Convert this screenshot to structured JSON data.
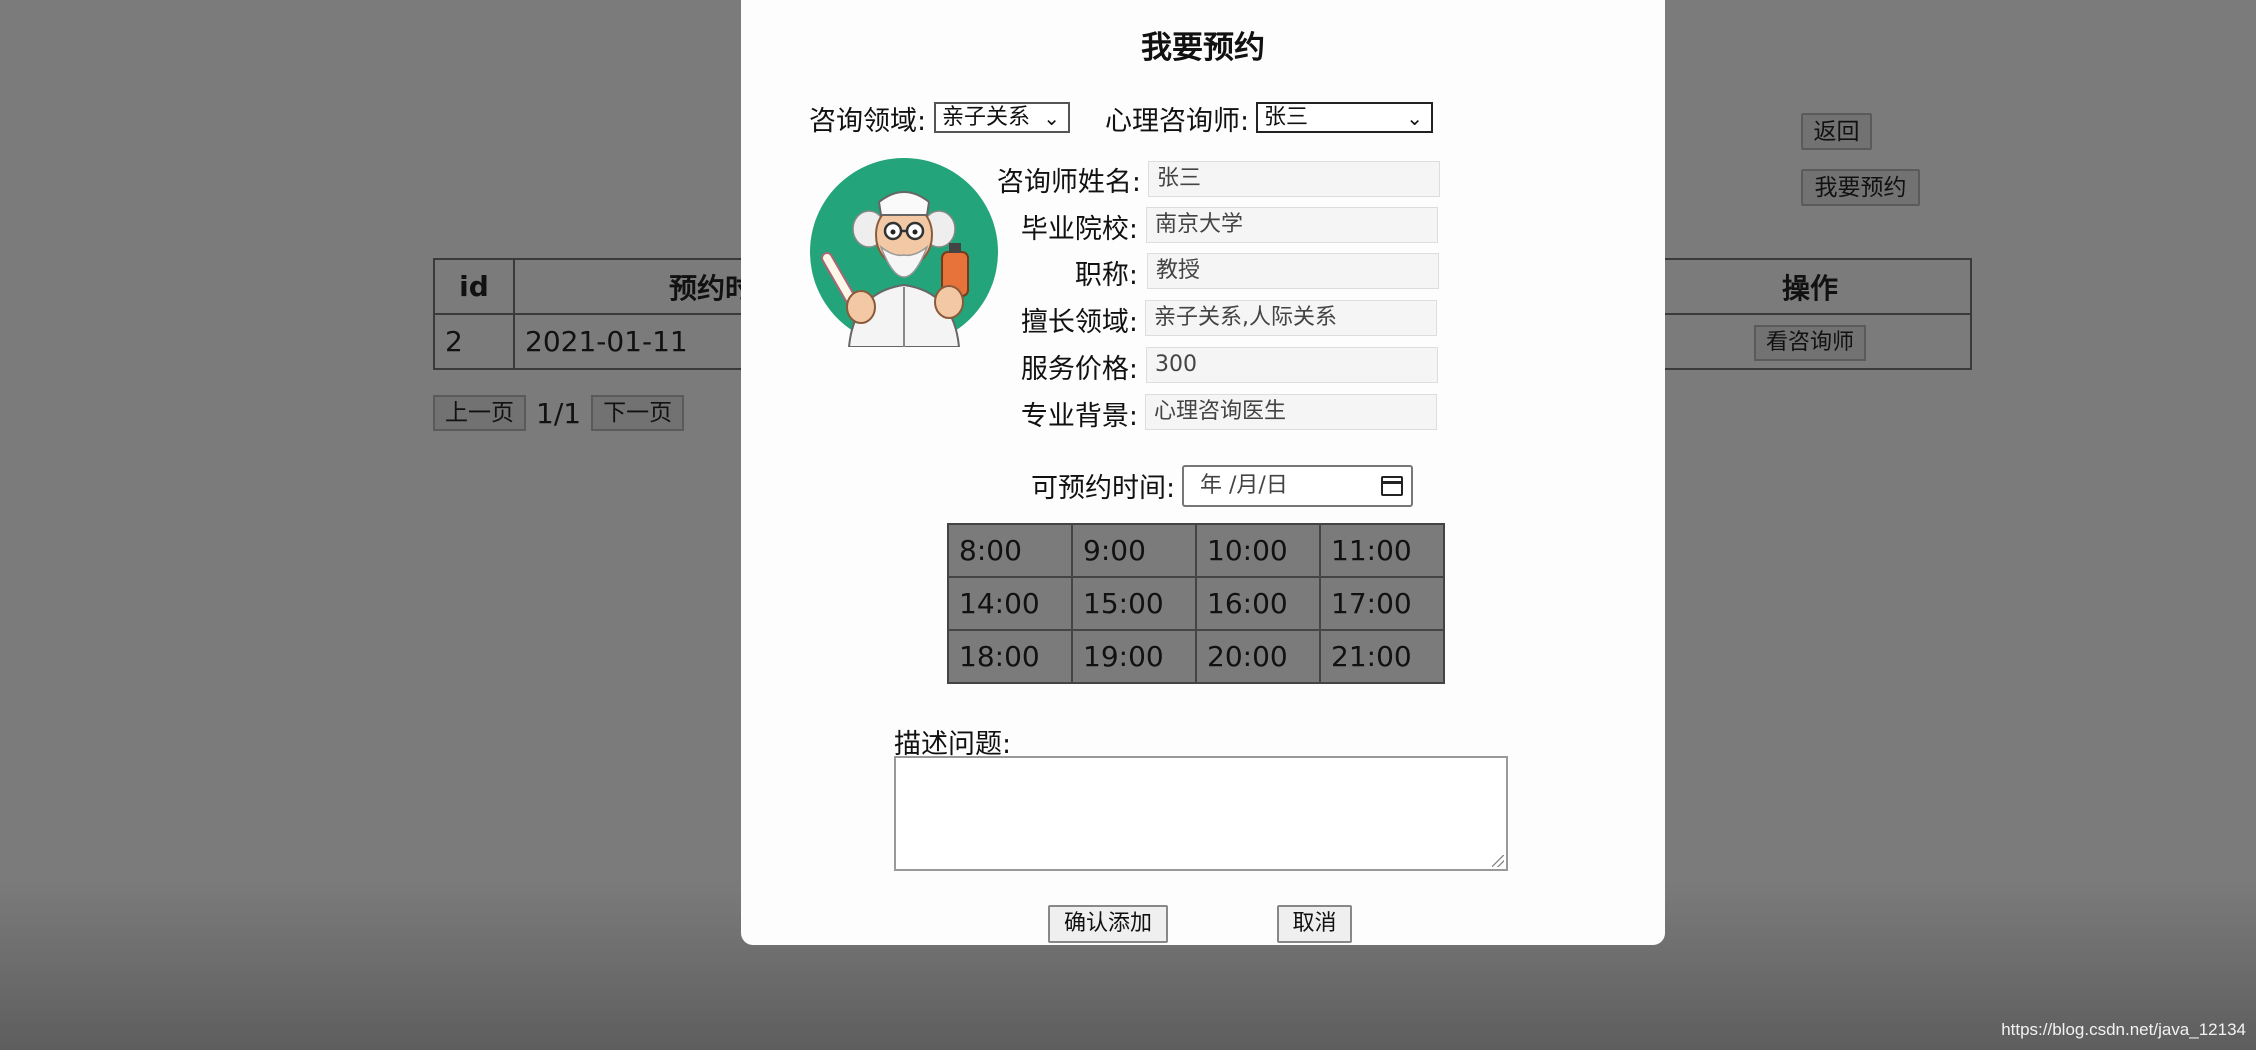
{
  "background": {
    "back_button": "返回",
    "book_button": "我要预约",
    "table": {
      "headers": [
        "id",
        "预约时间",
        "操作"
      ],
      "rows": [
        {
          "id": "2",
          "time": "2021-01-11",
          "action": "看咨询师"
        }
      ]
    },
    "pager": {
      "prev": "上一页",
      "info": "1/1",
      "next": "下一页"
    },
    "watermark": "https://blog.csdn.net/java_12134"
  },
  "modal": {
    "title": "我要预约",
    "field_label": "咨询领域:",
    "field_value": "亲子关系",
    "counselor_label": "心理咨询师:",
    "counselor_value": "张三",
    "info": [
      {
        "label": "咨询师姓名:",
        "value": "张三"
      },
      {
        "label": "毕业院校:",
        "value": "南京大学"
      },
      {
        "label": "职称:",
        "value": "教授"
      },
      {
        "label": "擅长领域:",
        "value": "亲子关系,人际关系"
      },
      {
        "label": "服务价格:",
        "value": "300"
      },
      {
        "label": "专业背景:",
        "value": "心理咨询医生"
      }
    ],
    "date_label": "可预约时间:",
    "date_placeholder": "年 /月/日",
    "slots": [
      [
        "8:00",
        "9:00",
        "10:00",
        "11:00"
      ],
      [
        "14:00",
        "15:00",
        "16:00",
        "17:00"
      ],
      [
        "18:00",
        "19:00",
        "20:00",
        "21:00"
      ]
    ],
    "desc_label": "描述问题:",
    "desc_value": "",
    "confirm": "确认添加",
    "cancel": "取消"
  },
  "icons": {
    "avatar": "doctor-avatar-icon",
    "select_arrow": "chevron-down-icon",
    "calendar": "calendar-icon"
  }
}
